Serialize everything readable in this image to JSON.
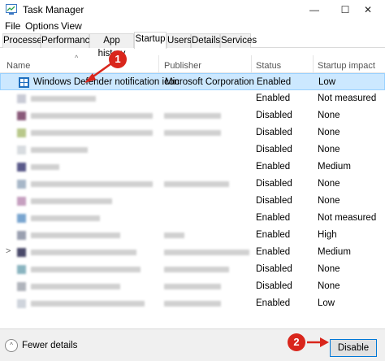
{
  "window": {
    "title": "Task Manager",
    "controls": {
      "minimize": "—",
      "maximize": "☐",
      "close": "✕"
    }
  },
  "menu": [
    "File",
    "Options",
    "View"
  ],
  "tabs": [
    "Processes",
    "Performance",
    "App history",
    "Startup",
    "Users",
    "Details",
    "Services"
  ],
  "active_tab": "Startup",
  "columns": {
    "name": "Name",
    "publisher": "Publisher",
    "status": "Status",
    "impact": "Startup impact"
  },
  "rows": [
    {
      "name": "Windows Defender notification icon",
      "publisher": "Microsoft Corporation",
      "status": "Enabled",
      "impact": "Low",
      "selected": true
    },
    {
      "name": "",
      "publisher": "",
      "status": "Enabled",
      "impact": "Not measured"
    },
    {
      "name": "",
      "publisher": "",
      "status": "Disabled",
      "impact": "None"
    },
    {
      "name": "",
      "publisher": "",
      "status": "Disabled",
      "impact": "None"
    },
    {
      "name": "",
      "publisher": "",
      "status": "Disabled",
      "impact": "None"
    },
    {
      "name": "",
      "publisher": "",
      "status": "Enabled",
      "impact": "Medium"
    },
    {
      "name": "",
      "publisher": "",
      "status": "Disabled",
      "impact": "None"
    },
    {
      "name": "",
      "publisher": "",
      "status": "Disabled",
      "impact": "None"
    },
    {
      "name": "",
      "publisher": "",
      "status": "Enabled",
      "impact": "Not measured"
    },
    {
      "name": "",
      "publisher": "",
      "status": "Enabled",
      "impact": "High"
    },
    {
      "name": "",
      "publisher": "",
      "status": "Enabled",
      "impact": "Medium"
    },
    {
      "name": "",
      "publisher": "",
      "status": "Disabled",
      "impact": "None"
    },
    {
      "name": "",
      "publisher": "",
      "status": "Disabled",
      "impact": "None"
    },
    {
      "name": "",
      "publisher": "",
      "status": "Enabled",
      "impact": "Low"
    }
  ],
  "footer": {
    "fewer_details": "Fewer details",
    "disable": "Disable"
  },
  "callouts": [
    "1",
    "2"
  ],
  "colors": {
    "selection": "#cce8ff",
    "callout": "#d9261c",
    "accent": "#0078d7"
  }
}
